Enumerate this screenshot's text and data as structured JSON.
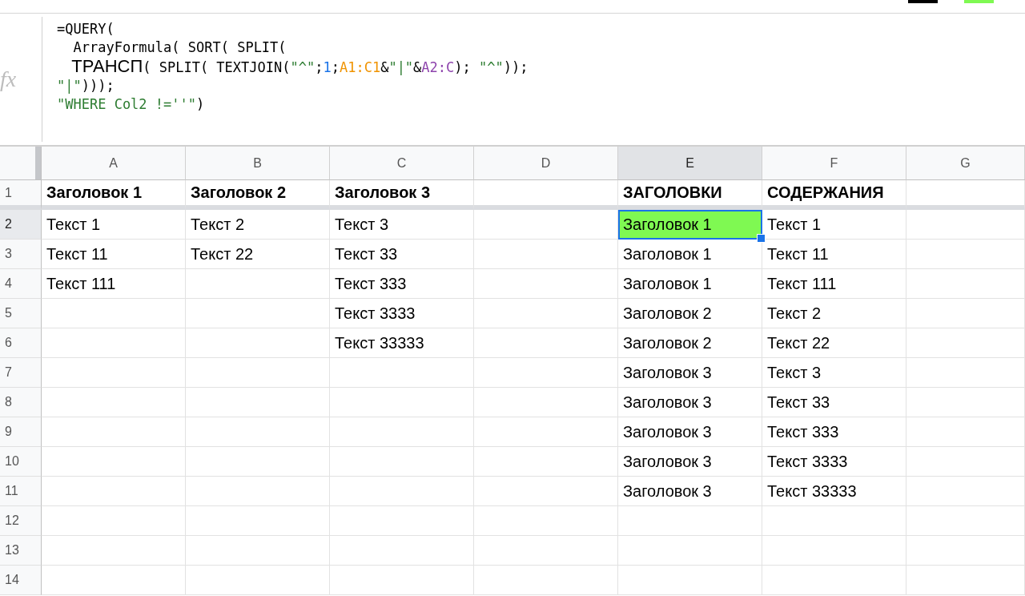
{
  "formula_bar": {
    "label": "fx",
    "lines": [
      [
        {
          "text": "=QUERY(",
          "kind": "plain"
        }
      ],
      [
        {
          "text": "  ArrayFormula( SORT( SPLIT(",
          "kind": "plain"
        }
      ],
      [
        {
          "text": "   ТРАНСП",
          "kind": "function"
        },
        {
          "text": "( SPLIT( TEXTJOIN(",
          "kind": "plain"
        },
        {
          "text": "\"^\"",
          "kind": "string"
        },
        {
          "text": ";",
          "kind": "plain"
        },
        {
          "text": "1",
          "kind": "number"
        },
        {
          "text": ";",
          "kind": "plain"
        },
        {
          "text": "A1:C1",
          "kind": "range_a"
        },
        {
          "text": "&",
          "kind": "plain"
        },
        {
          "text": "\"|\"",
          "kind": "string"
        },
        {
          "text": "&",
          "kind": "plain"
        },
        {
          "text": "A2:C",
          "kind": "range_b"
        },
        {
          "text": "); ",
          "kind": "plain"
        },
        {
          "text": "\"^\"",
          "kind": "string"
        },
        {
          "text": "));",
          "kind": "plain"
        }
      ],
      [
        {
          "text": "\"|\"",
          "kind": "string"
        },
        {
          "text": ")));",
          "kind": "plain"
        }
      ],
      [
        {
          "text": "\"WHERE Col2 !=''\"",
          "kind": "string"
        },
        {
          "text": ")",
          "kind": "plain"
        }
      ]
    ]
  },
  "sheet": {
    "columns": [
      {
        "label": "A",
        "selected": false
      },
      {
        "label": "B",
        "selected": false
      },
      {
        "label": "C",
        "selected": false
      },
      {
        "label": "D",
        "selected": false
      },
      {
        "label": "E",
        "selected": true
      },
      {
        "label": "F",
        "selected": false
      },
      {
        "label": "G",
        "selected": false
      }
    ],
    "header_row": {
      "label": "1",
      "selected": false,
      "cells": [
        "Заголовок 1",
        "Заголовок 2",
        "Заголовок 3",
        null,
        "ЗАГОЛОВКИ",
        "СОДЕРЖАНИЯ",
        null
      ]
    },
    "rows": [
      {
        "label": "2",
        "selected": true,
        "cells": [
          "Текст 1",
          "Текст 2",
          "Текст 3",
          null,
          {
            "text": "Заголовок 1",
            "color": "#7ff952"
          },
          "Текст 1",
          null
        ]
      },
      {
        "label": "3",
        "selected": false,
        "cells": [
          "Текст 11",
          "Текст 22",
          "Текст 33",
          null,
          "Заголовок 1",
          "Текст 11",
          null
        ]
      },
      {
        "label": "4",
        "selected": false,
        "cells": [
          "Текст 111",
          null,
          "Текст 333",
          null,
          "Заголовок 1",
          "Текст 111",
          null
        ]
      },
      {
        "label": "5",
        "selected": false,
        "cells": [
          null,
          null,
          "Текст 3333",
          null,
          "Заголовок 2",
          "Текст 2",
          null
        ]
      },
      {
        "label": "6",
        "selected": false,
        "cells": [
          null,
          null,
          "Текст 33333",
          null,
          "Заголовок 2",
          "Текст 22",
          null
        ]
      },
      {
        "label": "7",
        "selected": false,
        "cells": [
          null,
          null,
          null,
          null,
          "Заголовок 3",
          "Текст 3",
          null
        ]
      },
      {
        "label": "8",
        "selected": false,
        "cells": [
          null,
          null,
          null,
          null,
          "Заголовок 3",
          "Текст 33",
          null
        ]
      },
      {
        "label": "9",
        "selected": false,
        "cells": [
          null,
          null,
          null,
          null,
          "Заголовок 3",
          "Текст 333",
          null
        ]
      },
      {
        "label": "10",
        "selected": false,
        "cells": [
          null,
          null,
          null,
          null,
          "Заголовок 3",
          "Текст 3333",
          null
        ]
      },
      {
        "label": "11",
        "selected": false,
        "cells": [
          null,
          null,
          null,
          null,
          "Заголовок 3",
          "Текст 33333",
          null
        ]
      },
      {
        "label": "12",
        "selected": false,
        "cells": [
          null,
          null,
          null,
          null,
          null,
          null,
          null
        ]
      },
      {
        "label": "13",
        "selected": false,
        "cells": [
          null,
          null,
          null,
          null,
          null,
          null,
          null
        ]
      },
      {
        "label": "14",
        "selected": false,
        "cells": [
          null,
          null,
          null,
          null,
          null,
          null,
          null
        ]
      }
    ]
  }
}
